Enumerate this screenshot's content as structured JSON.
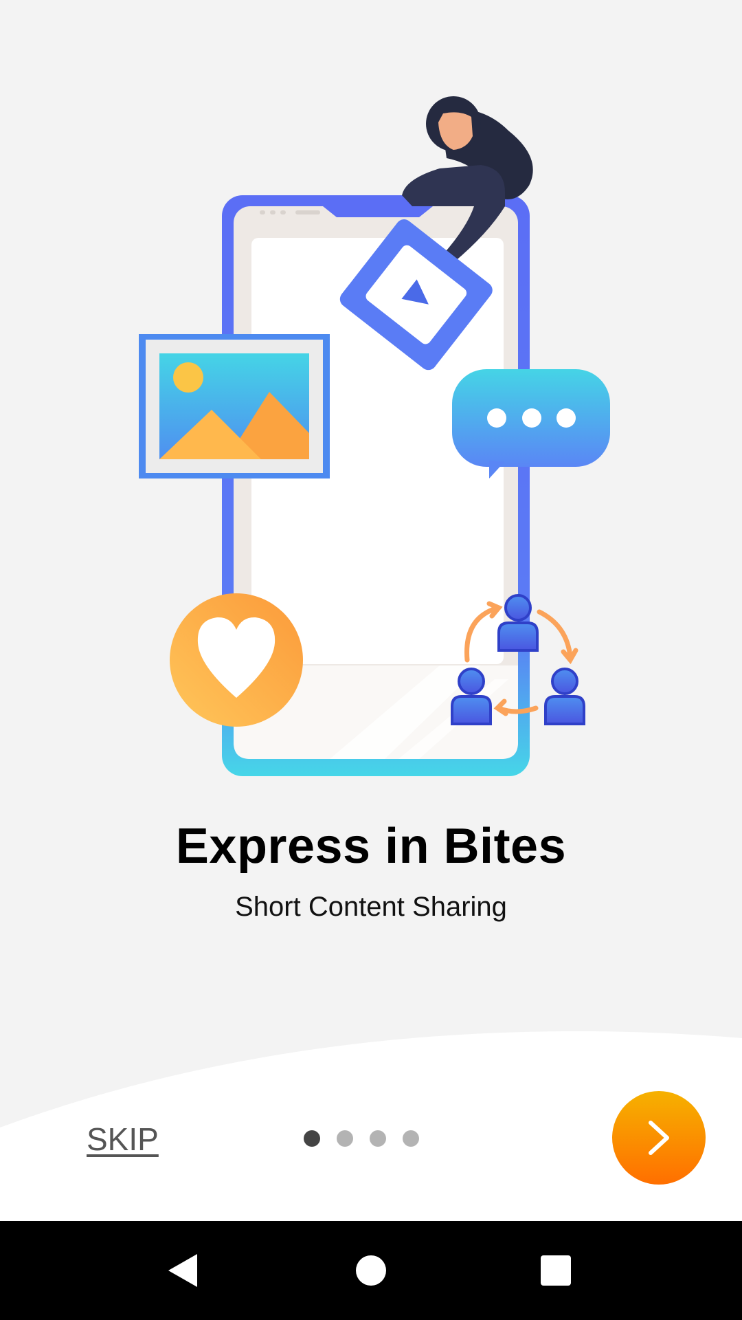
{
  "onboarding": {
    "title": "Express in Bites",
    "subtitle": "Short Content Sharing",
    "skip_label": "SKIP",
    "page_indicator": {
      "current": 1,
      "total": 4
    }
  },
  "icons": {
    "next": "chevron-right-icon",
    "nav_back": "back-triangle-icon",
    "nav_home": "home-circle-icon",
    "nav_recents": "recents-square-icon"
  },
  "colors": {
    "background": "#f3f3f3",
    "next_button_top": "#f6b100",
    "next_button_bottom": "#ff6f00",
    "active_dot": "#444444",
    "inactive_dot": "#b3b3b3",
    "phone_frame": "#5b7bf5",
    "accent_orange": "#fba340"
  }
}
